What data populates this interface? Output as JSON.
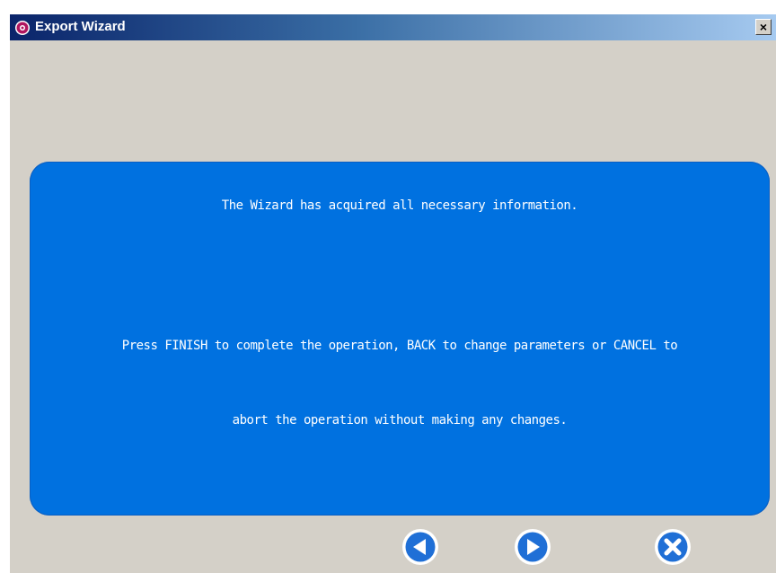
{
  "window": {
    "title": "Export Wizard",
    "close_glyph": "×",
    "title_icon": "app-icon"
  },
  "panel": {
    "line1": "The Wizard has acquired all necessary information.",
    "line2": "Press FINISH to complete the operation, BACK to change parameters or CANCEL to",
    "line3": "abort the operation without making any changes."
  },
  "buttons": {
    "back_icon": "back-arrow-icon",
    "finish_icon": "next-arrow-icon",
    "cancel_icon": "cancel-x-icon"
  },
  "colors": {
    "panel": "#0071e0",
    "button_fill": "#1f6fd6",
    "titlebar_start": "#0a246a",
    "titlebar_end": "#a6caf0"
  }
}
